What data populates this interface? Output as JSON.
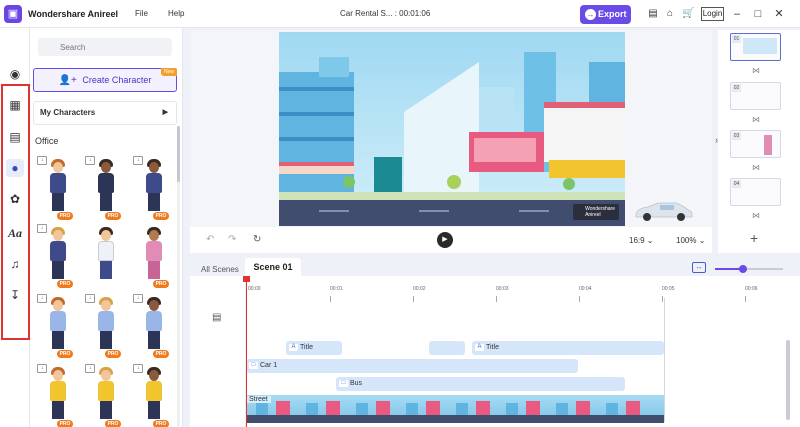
{
  "app": {
    "name": "Wondershare Anireel",
    "logo_icon": "film-camera-icon",
    "menu": [
      "File",
      "Help"
    ],
    "doc_title": "Car Rental S... : 00:01:06",
    "export_label": "Export",
    "login_label": "Login",
    "accent_color": "#6b4be8"
  },
  "sidebar_icons": [
    "scene-icon",
    "media-icon",
    "background-icon",
    "character-icon",
    "prop-icon",
    "text-icon",
    "music-icon",
    "import-icon"
  ],
  "panel": {
    "search_placeholder": "Search",
    "create_character_label": "Create Character",
    "create_badge": "New",
    "my_characters_label": "My Characters",
    "section_label": "Office",
    "pro_label": "PRO"
  },
  "preview": {
    "watermark_line1": "Wondershare",
    "watermark_line2": "Anireel",
    "aspect_ratio": "16:9",
    "zoom": "100%"
  },
  "scenes": {
    "numbers": [
      "01",
      "02",
      "03",
      "04"
    ]
  },
  "timeline": {
    "tabs": [
      "All Scenes",
      "Scene 01"
    ],
    "ruler": [
      "00:00",
      "00:01",
      "00:02",
      "00:03",
      "00:04",
      "00:05",
      "00:06"
    ],
    "tracks": [
      {
        "label": "Title"
      },
      {
        "label": "Title"
      },
      {
        "label": "Car 1"
      },
      {
        "label": "Bus"
      }
    ],
    "background_label": "Street"
  }
}
